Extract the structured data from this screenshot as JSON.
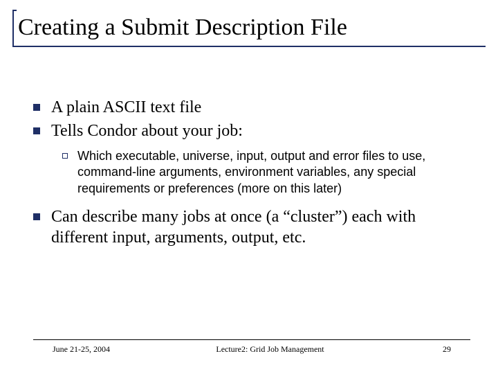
{
  "title": "Creating a Submit Description File",
  "bullets": {
    "b1": "A plain ASCII text file",
    "b2": "Tells Condor about your job:",
    "b2_sub1": "Which executable, universe, input, output and error files to use, command-line arguments, environment variables, any special requirements or preferences (more on this later)",
    "b3": "Can describe many jobs at once (a “cluster”) each with different input, arguments, output, etc."
  },
  "footer": {
    "date": "June 21-25, 2004",
    "center": "Lecture2: Grid Job Management",
    "page": "29"
  }
}
